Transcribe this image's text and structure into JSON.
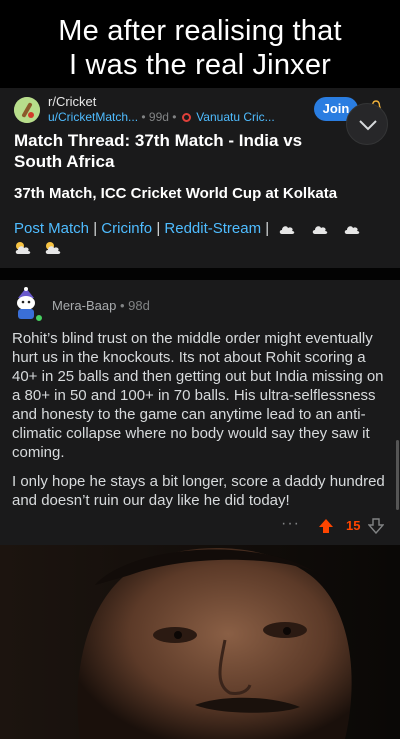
{
  "meme": {
    "caption_line1": "Me after realising that",
    "caption_line2": "I was the real Jinxer"
  },
  "post": {
    "subreddit": "r/Cricket",
    "author": "u/CricketMatch...",
    "age": "99d",
    "flair": "Vanuatu Cric...",
    "join_label": "Join",
    "title": "Match Thread: 37th Match - India vs South Africa",
    "subtitle": "37th Match, ICC Cricket World Cup at Kolkata",
    "links": [
      "Post Match",
      "Cricinfo",
      "Reddit-Stream"
    ],
    "separator": "|",
    "bullet": "•"
  },
  "comment": {
    "author": "Mera-Baap",
    "age": "98d",
    "paragraph1": "Rohit’s blind trust on the middle order might eventually hurt us in the knockouts. Its not about Rohit scoring a 40+ in 25 balls and then getting out but India missing on a 80+ in 50 and 100+ in 70 balls. His ultra-selflessness and honesty to the game can anytime lead to an anti-climatic collapse where no body would say they saw it coming.",
    "paragraph2": "I only hope he stays a bit longer, score a daddy hundred and doesn’t ruin our day like he did today!",
    "more_label": "···",
    "score": "15"
  },
  "colors": {
    "accent_blue": "#4fbcff",
    "join_blue": "#2a7de1",
    "upvote_orange": "#ff4500",
    "online_green": "#46d160",
    "card_bg": "#1a1a1b"
  },
  "icons": [
    "subreddit-avatar",
    "bell-icon",
    "chevron-down-icon",
    "cloud-icon",
    "user-avatar",
    "upvote-icon",
    "downvote-icon"
  ]
}
